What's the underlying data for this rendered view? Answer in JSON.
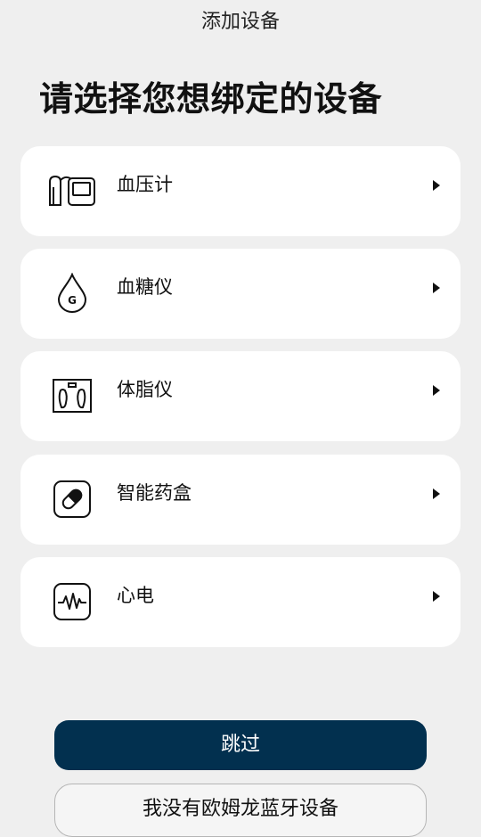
{
  "header": {
    "title": "添加设备"
  },
  "main": {
    "heading": "请选择您想绑定的设备",
    "devices": [
      {
        "label": "血压计",
        "icon": "blood-pressure-monitor-icon"
      },
      {
        "label": "血糖仪",
        "icon": "glucose-drop-icon",
        "icon_text": "G"
      },
      {
        "label": "体脂仪",
        "icon": "body-fat-scale-icon"
      },
      {
        "label": "智能药盒",
        "icon": "pill-box-icon"
      },
      {
        "label": "心电",
        "icon": "ecg-icon"
      }
    ]
  },
  "footer": {
    "skip_label": "跳过",
    "no_device_label": "我没有欧姆龙蓝牙设备"
  },
  "colors": {
    "background": "#efefef",
    "card": "#ffffff",
    "primary_button": "#02304f"
  }
}
